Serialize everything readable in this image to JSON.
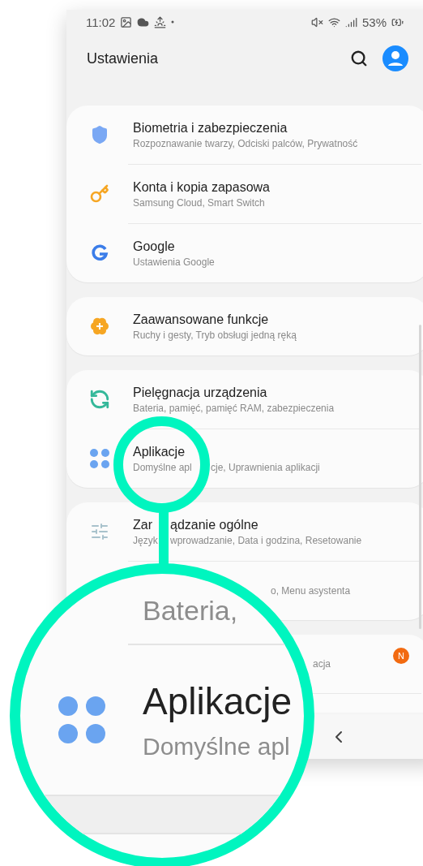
{
  "status_bar": {
    "time": "11:02",
    "battery": "53%"
  },
  "header": {
    "title": "Ustawienia"
  },
  "groups": [
    {
      "items": [
        {
          "kind": "full",
          "title": "Biometria i zabezpieczenia",
          "subtitle": "Rozpoznawanie twarzy, Odciski palców, Prywatność"
        },
        {
          "kind": "full",
          "title": "Konta i kopia zapasowa",
          "subtitle": "Samsung Cloud, Smart Switch"
        },
        {
          "kind": "full",
          "title": "Google",
          "subtitle": "Ustawienia Google"
        }
      ]
    },
    {
      "items": [
        {
          "kind": "full",
          "title": "Zaawansowane funkcje",
          "subtitle": "Ruchy i gesty, Tryb obsługi jedną ręką"
        }
      ]
    },
    {
      "items": [
        {
          "kind": "full",
          "title": "Pielęgnacja urządzenia",
          "subtitle": "Bateria, pamięć, pamięć RAM, zabezpieczenia"
        },
        {
          "kind": "ring",
          "title": "Aplikacje",
          "subtitle": [
            "Domyślne apl",
            "cje, Uprawnienia aplikacji"
          ]
        }
      ]
    },
    {
      "items": [
        {
          "kind": "stem",
          "title": [
            "Zar",
            "ądzanie ogólne"
          ],
          "subtitle": [
            "Język",
            "wprowadzanie, Data i godzina, Resetowanie"
          ]
        },
        {
          "kind": "partial",
          "subtitle": "o, Menu asystenta"
        }
      ]
    },
    {
      "items": [
        {
          "kind": "partial",
          "subtitle": "acja",
          "badge": "N"
        },
        {
          "kind": "empty"
        }
      ]
    }
  ],
  "magnifier": {
    "top_text": "Bateria,",
    "title": "Aplikacje",
    "subtitle": "Domyślne apl"
  }
}
